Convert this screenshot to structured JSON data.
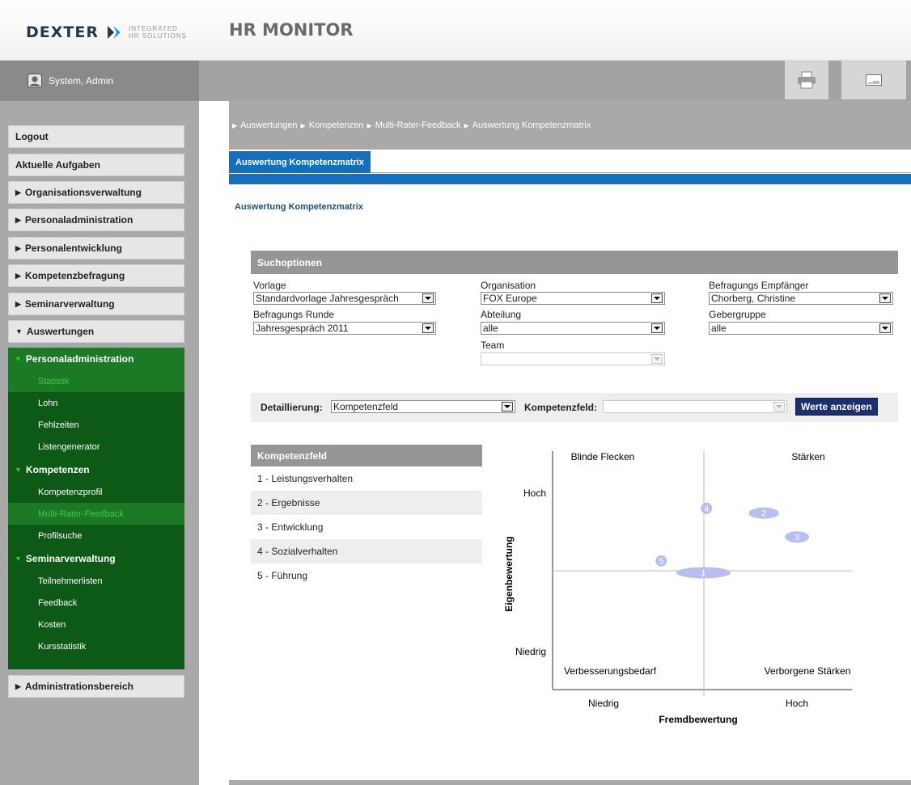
{
  "header": {
    "logo_word": "DEXTER",
    "logo_sub_line1": "INTEGRATED",
    "logo_sub_line2": "HR SOLUTIONS",
    "app_title": "HR MONITOR"
  },
  "userbar": {
    "user_name": "System, Admin",
    "user_icon": "user-icon",
    "print_icon": "printer-icon",
    "message_icon": "message-icon"
  },
  "sidebar": {
    "logout": "Logout",
    "tasks": "Aktuelle Aufgaben",
    "items": [
      {
        "label": "Organisationsverwaltung"
      },
      {
        "label": "Personaladministration"
      },
      {
        "label": "Personalentwicklung"
      },
      {
        "label": "Kompetenzbefragung"
      },
      {
        "label": "Seminarverwaltung"
      },
      {
        "label": "Auswertungen"
      }
    ],
    "sub_personal": {
      "title": "Personaladministration",
      "items": [
        "Statistik",
        "Lohn",
        "Fehlzeiten",
        "Listengenerator"
      ]
    },
    "sub_kompetenzen": {
      "title": "Kompetenzen",
      "items": [
        "Kompetenzprofil",
        "Multi-Rater-Feedback",
        "Profilsuche"
      ]
    },
    "sub_seminar": {
      "title": "Seminarverwaltung",
      "items": [
        "Teilnehmerlisten",
        "Feedback",
        "Kosten",
        "Kursstatistik"
      ]
    },
    "admin": "Administrationsbereich"
  },
  "breadcrumb": [
    "Auswertungen",
    "Kompetenzen",
    "Multi-Rater-Feedback",
    "Auswertung Kompetenzmatrix"
  ],
  "tab": {
    "label": "Auswertung Kompetenzmatrix"
  },
  "page_title": "Auswertung Kompetenzmatrix",
  "search": {
    "heading": "Suchoptionen",
    "vorlage_label": "Vorlage",
    "vorlage_value": "Standardvorlage Jahresgespräch",
    "runde_label": "Befragungs Runde",
    "runde_value": "Jahresgespräch 2011",
    "organisation_label": "Organisation",
    "organisation_value": "FOX Europe",
    "abteilung_label": "Abteilung",
    "abteilung_value": "alle",
    "team_label": "Team",
    "team_value": "",
    "empfaenger_label": "Befragungs Empfänger",
    "empfaenger_value": "Chorberg, Christine",
    "gebergruppe_label": "Gebergruppe",
    "gebergruppe_value": "alle"
  },
  "detail": {
    "detaillierung_label": "Detaillierung:",
    "detaillierung_value": "Kompetenzfeld",
    "kompetenzfeld_label": "Kompetenzfeld:",
    "kompetenzfeld_value": "",
    "button": "Werte anzeigen"
  },
  "kompetenzfeld_table": {
    "header": "Kompetenzfeld",
    "rows": [
      "1 - Leistungsverhalten",
      "2 - Ergebnisse",
      "3 - Entwicklung",
      "4 - Sozialverhalten",
      "5 - Führung"
    ]
  },
  "chart_data": {
    "type": "scatter",
    "xlabel": "Fremdbewertung",
    "ylabel": "Eigenbewertung",
    "x_ticks": [
      "Niedrig",
      "Hoch"
    ],
    "y_ticks": [
      "Hoch",
      "Niedrig"
    ],
    "quadrants": {
      "top_left": "Blinde Flecken",
      "top_right": "Stärken",
      "bottom_left": "Verbesserungsbedarf",
      "bottom_right": "Verborgene Stärken"
    },
    "xlim": [
      0,
      1
    ],
    "ylim": [
      0,
      1
    ],
    "points": [
      {
        "label": "1",
        "x": 0.5,
        "y": 0.49,
        "spread_x": 0.09,
        "spread_y": 0.02
      },
      {
        "label": "2",
        "x": 0.7,
        "y": 0.74,
        "spread_x": 0.05,
        "spread_y": 0.02
      },
      {
        "label": "3",
        "x": 0.81,
        "y": 0.64,
        "spread_x": 0.04,
        "spread_y": 0.02
      },
      {
        "label": "4",
        "x": 0.51,
        "y": 0.76,
        "spread_x": 0.012,
        "spread_y": 0.02
      },
      {
        "label": "5",
        "x": 0.36,
        "y": 0.54,
        "spread_x": 0.012,
        "spread_y": 0.02
      }
    ],
    "bubble_color": "#b6bff0"
  }
}
